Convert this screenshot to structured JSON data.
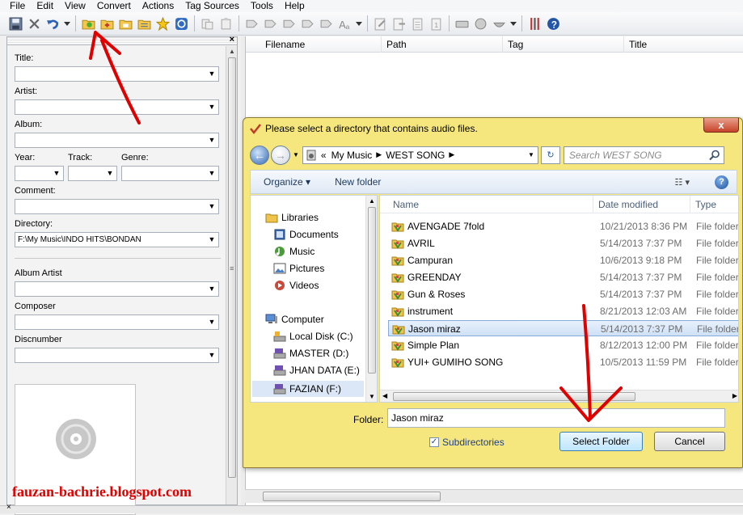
{
  "menu": [
    "File",
    "Edit",
    "View",
    "Convert",
    "Actions",
    "Tag Sources",
    "Tools",
    "Help"
  ],
  "tag_panel": {
    "title_label": "Title:",
    "artist_label": "Artist:",
    "album_label": "Album:",
    "year_label": "Year:",
    "track_label": "Track:",
    "genre_label": "Genre:",
    "comment_label": "Comment:",
    "directory_label": "Directory:",
    "directory_value": "F:\\My Music\\INDO HITS\\BONDAN",
    "album_artist_label": "Album Artist",
    "composer_label": "Composer",
    "discnumber_label": "Discnumber",
    "close_glyph": "×"
  },
  "grid": {
    "columns": [
      "Filename",
      "Path",
      "Tag",
      "Title"
    ]
  },
  "dialog": {
    "title": "Please select a directory that contains audio files.",
    "close_glyph": "x",
    "breadcrumb": [
      "My Music",
      "WEST SONG"
    ],
    "breadcrumb_prefix": "«",
    "search_placeholder": "Search WEST SONG",
    "organize_label": "Organize",
    "new_folder_label": "New folder",
    "nav": {
      "libraries": "Libraries",
      "documents": "Documents",
      "music": "Music",
      "pictures": "Pictures",
      "videos": "Videos",
      "computer": "Computer",
      "drives": [
        "Local Disk (C:)",
        "MASTER (D:)",
        "JHAN DATA (E:)",
        "FAZIAN (F:)"
      ]
    },
    "columns": [
      "Name",
      "Date modified",
      "Type"
    ],
    "files": [
      {
        "name": "AVENGADE 7fold",
        "date": "10/21/2013 8:36 PM",
        "type": "File folder"
      },
      {
        "name": "AVRIL",
        "date": "5/14/2013 7:37 PM",
        "type": "File folder"
      },
      {
        "name": "Campuran",
        "date": "10/6/2013 9:18 PM",
        "type": "File folder"
      },
      {
        "name": "GREENDAY",
        "date": "5/14/2013 7:37 PM",
        "type": "File folder"
      },
      {
        "name": "Gun & Roses",
        "date": "5/14/2013 7:37 PM",
        "type": "File folder"
      },
      {
        "name": "instrument",
        "date": "8/21/2013 12:03 AM",
        "type": "File folder"
      },
      {
        "name": "Jason miraz",
        "date": "5/14/2013 7:37 PM",
        "type": "File folder"
      },
      {
        "name": "Simple Plan",
        "date": "8/12/2013 12:00 PM",
        "type": "File folder"
      },
      {
        "name": "YUI+ GUMIHO SONG",
        "date": "10/5/2013 11:59 PM",
        "type": "File folder"
      }
    ],
    "selected_index": 6,
    "folder_label": "Folder:",
    "folder_value": "Jason miraz",
    "subdirectories_label": "Subdirectories",
    "subdirectories_checked": true,
    "select_button": "Select Folder",
    "cancel_button": "Cancel"
  },
  "watermark": "fauzan-bachrie.blogspot.com",
  "colors": {
    "annotation": "#e00000",
    "dialog_frame": "#f5e77e",
    "selection": "#cfe1f6"
  }
}
